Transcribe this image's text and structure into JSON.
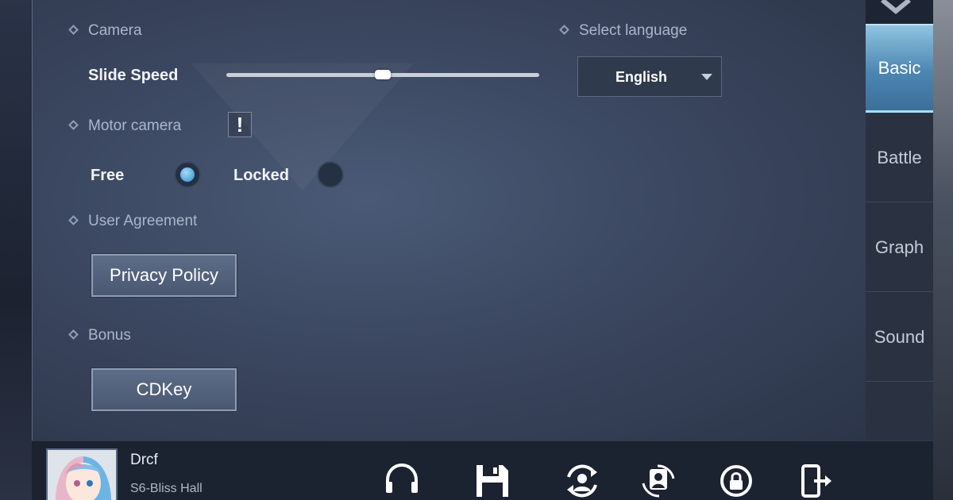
{
  "settings": {
    "camera": {
      "heading": "Camera",
      "slide_speed_label": "Slide Speed",
      "slide_speed_value": 0.5
    },
    "motor_camera": {
      "heading": "Motor camera",
      "info_icon": "!",
      "free_label": "Free",
      "locked_label": "Locked",
      "selected": "Free"
    },
    "user_agreement": {
      "heading": "User Agreement",
      "privacy_policy_label": "Privacy Policy"
    },
    "bonus": {
      "heading": "Bonus",
      "cdkey_label": "CDKey"
    },
    "language": {
      "heading": "Select language",
      "selected": "English"
    }
  },
  "tabs": [
    {
      "label": "Basic",
      "active": true
    },
    {
      "label": "Battle",
      "active": false
    },
    {
      "label": "Graph",
      "active": false
    },
    {
      "label": "Sound",
      "active": false
    }
  ],
  "player": {
    "name": "Drcf",
    "server": "S6-Bliss Hall"
  },
  "bottom_icons": [
    "headset-icon",
    "save-icon",
    "switch-account-icon",
    "switch-character-icon",
    "lock-rotation-icon",
    "exit-icon"
  ],
  "colors": {
    "accent": "#4fa6dc",
    "panel": "#3b4760",
    "tab_active": "#4b86b2"
  }
}
